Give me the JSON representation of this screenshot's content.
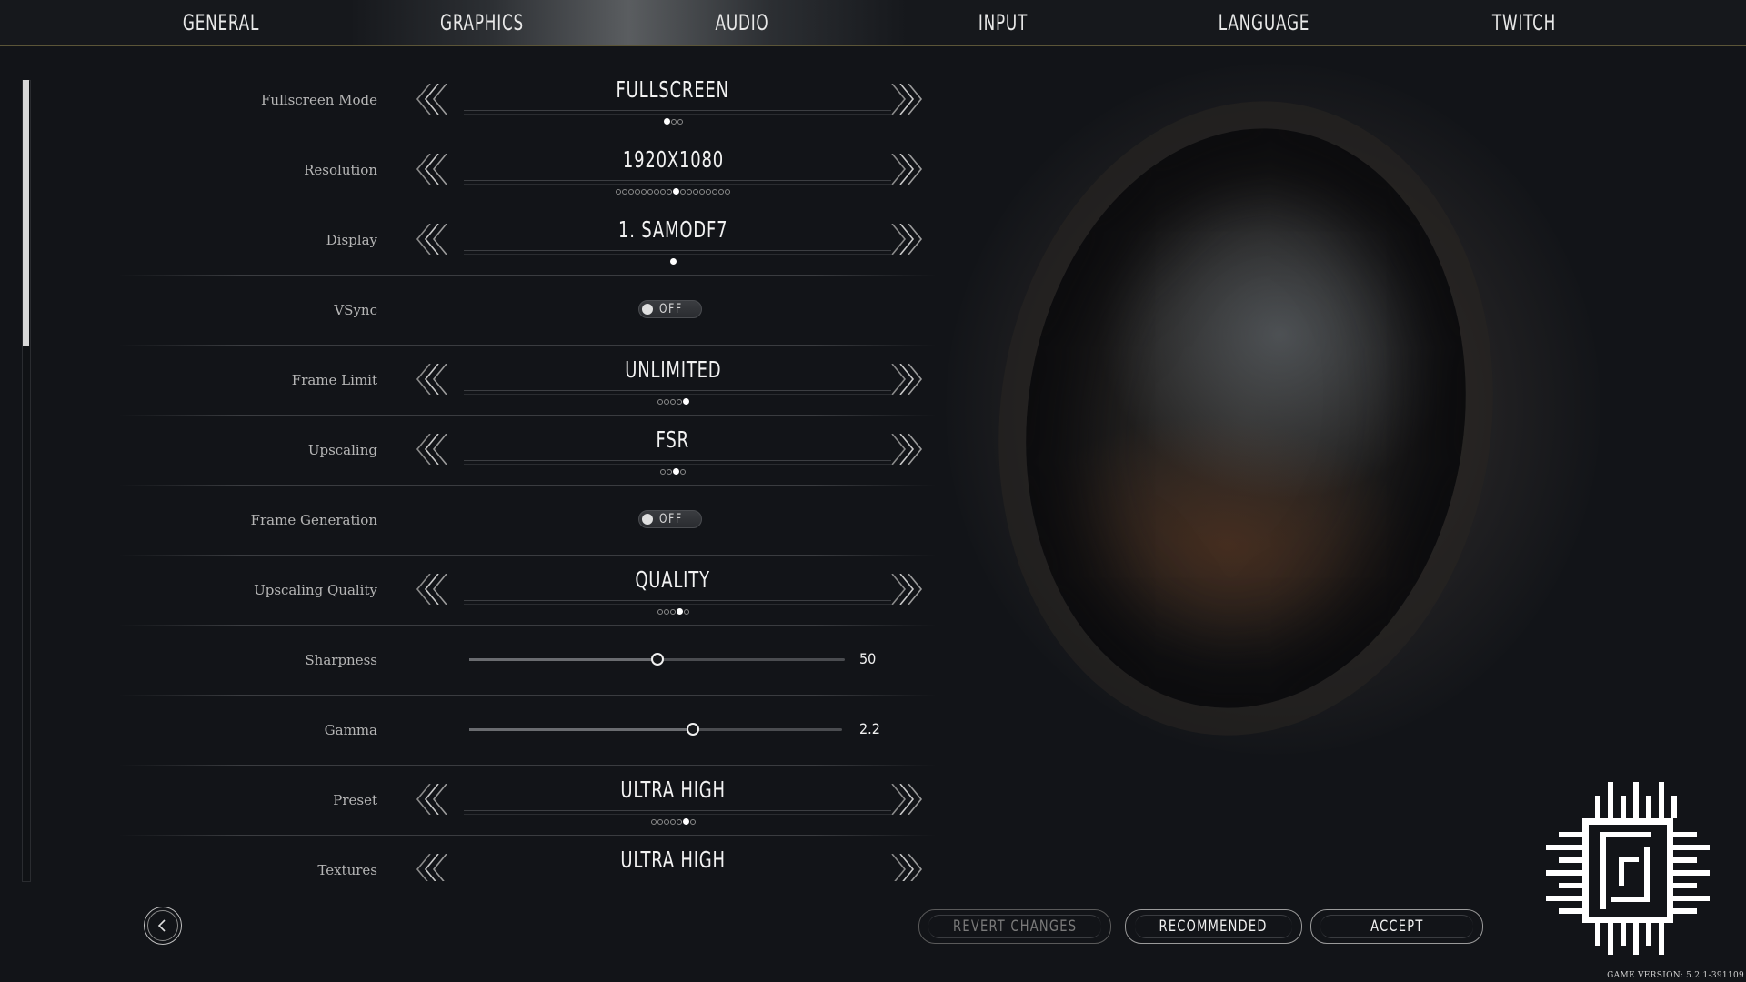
{
  "nav": {
    "tabs": [
      {
        "label": "GENERAL",
        "active": false
      },
      {
        "label": "GRAPHICS",
        "active": true
      },
      {
        "label": "AUDIO",
        "active": false
      },
      {
        "label": "INPUT",
        "active": false
      },
      {
        "label": "LANGUAGE",
        "active": false
      },
      {
        "label": "TWITCH",
        "active": false
      }
    ]
  },
  "settings": {
    "fullscreen_mode": {
      "label": "Fullscreen Mode",
      "value": "FULLSCREEN",
      "option_count": 3,
      "selected_index": 0
    },
    "resolution": {
      "label": "Resolution",
      "value": "1920X1080",
      "option_count": 18,
      "selected_index": 9
    },
    "display": {
      "label": "Display",
      "value": "1. SAMODF7",
      "option_count": 1,
      "selected_index": 0
    },
    "vsync": {
      "label": "VSync",
      "value": "OFF",
      "enabled": false
    },
    "frame_limit": {
      "label": "Frame Limit",
      "value": "UNLIMITED",
      "option_count": 5,
      "selected_index": 4
    },
    "upscaling": {
      "label": "Upscaling",
      "value": "FSR",
      "option_count": 4,
      "selected_index": 2
    },
    "frame_generation": {
      "label": "Frame Generation",
      "value": "OFF",
      "enabled": false
    },
    "upscaling_quality": {
      "label": "Upscaling Quality",
      "value": "QUALITY",
      "option_count": 5,
      "selected_index": 3
    },
    "sharpness": {
      "label": "Sharpness",
      "value": "50",
      "fraction": 0.5
    },
    "gamma": {
      "label": "Gamma",
      "value": "2.2",
      "fraction": 0.6
    },
    "preset": {
      "label": "Preset",
      "value": "ULTRA HIGH",
      "option_count": 7,
      "selected_index": 5
    },
    "textures": {
      "label": "Textures",
      "value": "ULTRA HIGH"
    }
  },
  "footer": {
    "revert_label": "REVERT CHANGES",
    "recommended_label": "RECOMMENDED",
    "accept_label": "ACCEPT",
    "back_icon": "chevron-left-icon",
    "version": "GAME VERSION: 5.2.1-391109"
  },
  "colors": {
    "background": "#121418",
    "accent_line": "#5b5538",
    "text": "#f2f2f2",
    "label": "#b5b5b5"
  }
}
